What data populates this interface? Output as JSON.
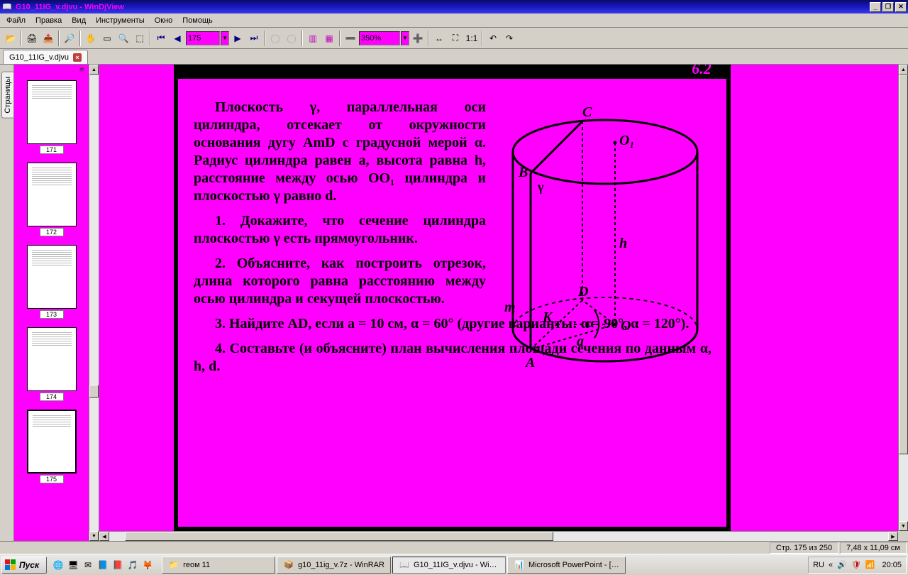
{
  "titlebar": {
    "title": "G10_11IG_v.djvu - WinDjView"
  },
  "winbtns": {
    "min": "_",
    "max": "❐",
    "close": "✕"
  },
  "menu": {
    "file": "Файл",
    "edit": "Правка",
    "view": "Вид",
    "tools": "Инструменты",
    "window": "Окно",
    "help": "Помощь"
  },
  "toolbar": {
    "page_value": "175",
    "zoom_value": "350%"
  },
  "doctab": {
    "label": "G10_11IG_v.djvu",
    "close": "×"
  },
  "sidebar": {
    "tab_label": "Страницы"
  },
  "thumbs": {
    "t1": "171",
    "t2": "172",
    "t3": "173",
    "t4": "174",
    "t5": "175"
  },
  "page": {
    "topnum": "6.2",
    "p1": "Плоскость γ, параллельная оси цилиндра, отсекает от ок­ружности основания дугу AmD с градусной мерой α. Радиус цилиндра равен a, высота рав­на h, расстояние между осью OO₁ цилиндра и плоскостью γ равно d.",
    "p2": "1. Докажите, что сечение цилиндра плоскостью γ есть прямоугольник.",
    "p3": "2. Объясните, как постро­ить отрезок, длина которого равна расстоянию между осью цилиндра и секущей плоско­стью.",
    "p4": "3. Найдите AD, если a = 10 см, α = 60° (другие ва­рианты: α = 90°, α = 120°).",
    "p5": "4. Составьте (и объясните) план вычисления пло­щади сечения по данным α, h, d."
  },
  "fig": {
    "C": "C",
    "O1": "O₁",
    "B": "B",
    "gamma": "γ",
    "h": "h",
    "D": "D",
    "m": "m",
    "K": "K",
    "alpha": "α",
    "O": "O",
    "a": "a",
    "A": "A"
  },
  "status": {
    "page": "Стр. 175 из 250",
    "size": "7,48 x 11,09 см"
  },
  "taskbar": {
    "start": "Пуск",
    "t1": "геом 11",
    "t2": "g10_11ig_v.7z - WinRAR",
    "t3": "G10_11IG_v.djvu - Wi…",
    "t4": "Microsoft PowerPoint - […",
    "lang": "RU",
    "clock": "20:05"
  }
}
